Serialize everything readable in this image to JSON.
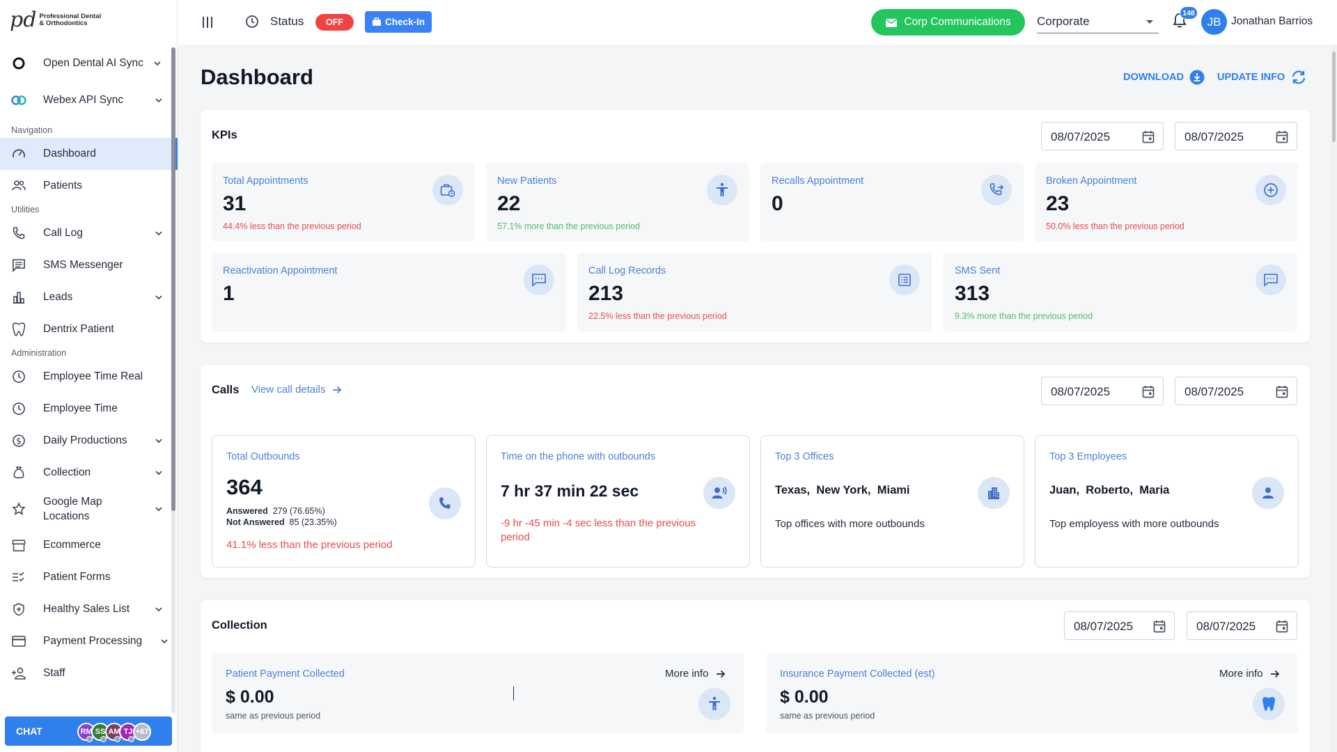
{
  "brand": {
    "logo_mark": "pd",
    "line1": "Professional Dental",
    "line2": "& Orthodontics"
  },
  "topbar": {
    "status_label": "Status",
    "status_value": "OFF",
    "checkin_label": "Check-In",
    "corp_comm_label": "Corp Communications",
    "org_select": "Corporate",
    "notifications": "148",
    "user_initials": "JB",
    "user_name": "Jonathan Barrios"
  },
  "sidebar": {
    "sync1": "Open Dental AI Sync",
    "sync2": "Webex API Sync",
    "nav_label": "Navigation",
    "dashboard": "Dashboard",
    "patients": "Patients",
    "utilities_label": "Utilities",
    "call_log": "Call Log",
    "sms": "SMS Messenger",
    "leads": "Leads",
    "dentrix": "Dentrix Patient",
    "admin_label": "Administration",
    "emp_time_real": "Employee Time Real",
    "emp_time": "Employee Time",
    "daily_prod": "Daily Productions",
    "collection": "Collection",
    "google_map_1": "Google Map",
    "google_map_2": "Locations",
    "ecommerce": "Ecommerce",
    "patient_forms": "Patient Forms",
    "healthy_sales": "Healthy Sales List",
    "payment": "Payment Processing",
    "staff": "Staff"
  },
  "chat": {
    "label": "CHAT",
    "avatars": [
      {
        "initials": "RM",
        "color": "#8b3fd1"
      },
      {
        "initials": "SS",
        "color": "#2e7d32"
      },
      {
        "initials": "AM",
        "color": "#7b3f61"
      },
      {
        "initials": "TJ",
        "color": "#9c27b0"
      },
      {
        "initials": "+67",
        "color": "#b8bcc4"
      }
    ]
  },
  "page": {
    "title": "Dashboard",
    "download": "DOWNLOAD",
    "update_info": "UPDATE INFO"
  },
  "kpis": {
    "title": "KPIs",
    "date_from": "08/07/2025",
    "date_to": "08/07/2025",
    "total_appointments": {
      "label": "Total Appointments",
      "value": "31",
      "delta": "44.4% less than the previous period"
    },
    "new_patients": {
      "label": "New Patients",
      "value": "22",
      "delta": "57.1% more than the previous period"
    },
    "recalls": {
      "label": "Recalls Appointment",
      "value": "0"
    },
    "broken": {
      "label": "Broken Appointment",
      "value": "23",
      "delta": "50.0% less than the previous period"
    },
    "reactivation": {
      "label": "Reactivation Appointment",
      "value": "1"
    },
    "call_log": {
      "label": "Call Log Records",
      "value": "213",
      "delta": "22.5% less than the previous period"
    },
    "sms_sent": {
      "label": "SMS Sent",
      "value": "313",
      "delta": "9.3% more than the previous period"
    }
  },
  "calls": {
    "title": "Calls",
    "view_details": "View call details",
    "date_from": "08/07/2025",
    "date_to": "08/07/2025",
    "outbounds": {
      "label": "Total Outbounds",
      "value": "364",
      "answered_label": "Answered",
      "answered_value": "279 (76.65%)",
      "not_answered_label": "Not Answered",
      "not_answered_value": "85 (23.35%)",
      "delta": "41.1% less than the previous period"
    },
    "phone_time": {
      "label": "Time on the phone with outbounds",
      "value": "7 hr 37 min 22 sec",
      "delta": "-9 hr -45 min -4 sec less than the previous period"
    },
    "offices": {
      "label": "Top 3 Offices",
      "value": "Texas,  New York,  Miami",
      "desc": "Top offices with more outbounds"
    },
    "employees": {
      "label": "Top 3 Employees",
      "value": "Juan,  Roberto,  Maria",
      "desc": "Top employess with more outbounds"
    }
  },
  "collection": {
    "title": "Collection",
    "date_from": "08/07/2025",
    "date_to": "08/07/2025",
    "patient": {
      "label": "Patient Payment Collected",
      "value": "$ 0.00",
      "sub": "same as previous period",
      "more": "More info"
    },
    "insurance": {
      "label": "Insurance Payment Collected (est)",
      "value": "$ 0.00",
      "sub": "same as previous period",
      "more": "More info"
    }
  }
}
